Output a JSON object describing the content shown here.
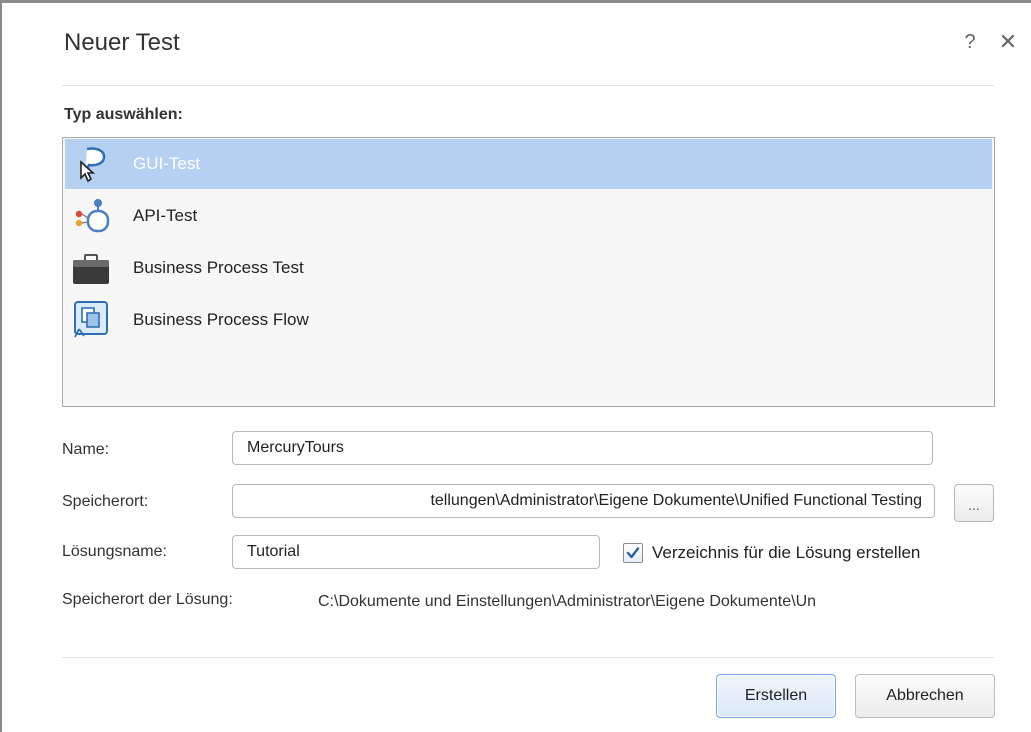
{
  "dialog": {
    "title": "Neuer Test",
    "help_label": "?",
    "close_label": "✕"
  },
  "type_section": {
    "label": "Typ auswählen:",
    "items": [
      {
        "label": "GUI-Test",
        "icon": "gui-test-icon",
        "selected": true
      },
      {
        "label": "API-Test",
        "icon": "api-test-icon",
        "selected": false
      },
      {
        "label": "Business Process Test",
        "icon": "business-process-test-icon",
        "selected": false
      },
      {
        "label": "Business Process Flow",
        "icon": "business-process-flow-icon",
        "selected": false
      }
    ]
  },
  "form": {
    "name_label": "Name:",
    "name_value": "MercuryTours",
    "location_label": "Speicherort:",
    "location_value": "tellungen\\Administrator\\Eigene Dokumente\\Unified Functional Testing",
    "browse_label": "...",
    "solution_name_label": "Lösungsname:",
    "solution_name_value": "Tutorial",
    "create_dir_label": "Verzeichnis für die Lösung erstellen",
    "create_dir_checked": true,
    "solution_location_label": "Speicherort der Lösung:",
    "solution_location_value": "C:\\Dokumente und Einstellungen\\Administrator\\Eigene Dokumente\\Un"
  },
  "buttons": {
    "create_label": "Erstellen",
    "cancel_label": "Abbrechen"
  },
  "colors": {
    "selection": "#b5d0f0",
    "primary_button_border": "#7aa6dc",
    "checkmark": "#2b5fa8"
  }
}
